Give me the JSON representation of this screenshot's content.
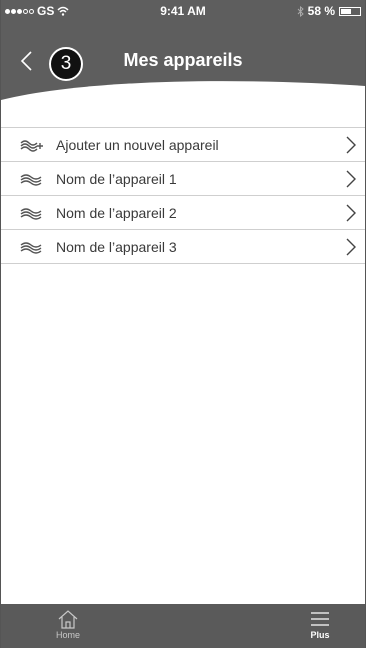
{
  "status_bar": {
    "carrier": "GS",
    "time": "9:41 AM",
    "battery": "58 %",
    "battery_level": 0.58
  },
  "header": {
    "back_icon": "chevron-left-icon",
    "step_number": "3",
    "title": "Mes appareils"
  },
  "devices": {
    "items": [
      {
        "label": "Ajouter un nouvel appareil",
        "icon": "add-device-icon"
      },
      {
        "label": "Nom de l’appareil 1",
        "icon": "device-waves-icon"
      },
      {
        "label": "Nom de l’appareil 2",
        "icon": "device-waves-icon"
      },
      {
        "label": "Nom de l’appareil 3",
        "icon": "device-waves-icon"
      }
    ]
  },
  "tabbar": {
    "home_label": "Home",
    "plus_label": "Plus"
  },
  "colors": {
    "header_bg": "#5e5e5e",
    "tabbar_bg": "#5a5a5a",
    "divider": "#cfcfcf"
  }
}
